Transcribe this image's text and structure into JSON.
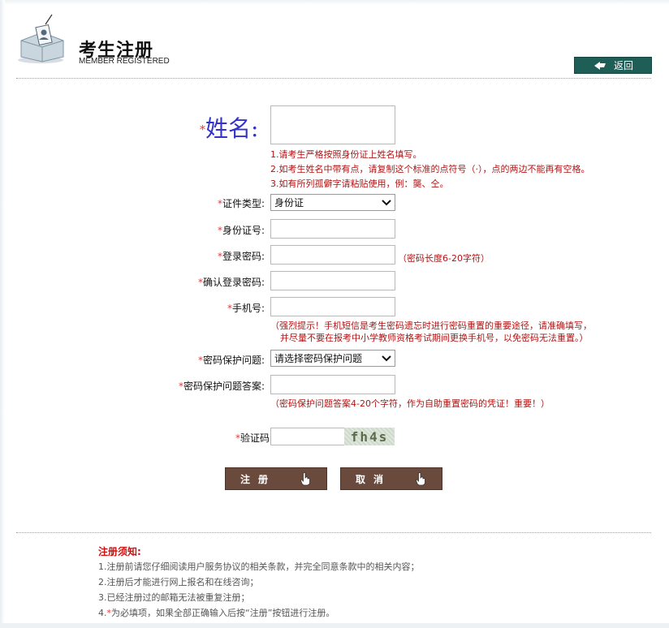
{
  "header": {
    "title_cn": "考生注册",
    "title_en": "MEMBER REGISTERED",
    "back_label": "返回"
  },
  "required_mark": "*",
  "form": {
    "name": {
      "label": "姓名:",
      "value": "",
      "tips": [
        "1.请考生严格按照身份证上姓名填写。",
        "2.如考生姓名中带有点，请复制这个标准的点符号（·），点的两边不能再有空格。",
        "3.如有所列孤僻字请粘贴使用，例：龑、仝。"
      ]
    },
    "id_type": {
      "label": "证件类型:",
      "selected": "身份证"
    },
    "id_number": {
      "label": "身份证号:",
      "value": ""
    },
    "password": {
      "label": "登录密码:",
      "value": "",
      "tip": "（密码长度6-20字符）"
    },
    "password_confirm": {
      "label": "确认登录密码:",
      "value": ""
    },
    "phone": {
      "label": "手机号:",
      "value": "",
      "tip_line1": "（强烈提示！手机短信是考生密码遗忘时进行密码重置的重要途径，请准确填写，",
      "tip_line2": "并尽量不要在报考中小学教师资格考试期间更换手机号，以免密码无法重置。）"
    },
    "security_question": {
      "label": "密码保护问题:",
      "selected": "请选择密码保护问题"
    },
    "security_answer": {
      "label": "密码保护问题答案:",
      "value": "",
      "tip": "（密码保护问题答案4-20个字符，作为自助重置密码的凭证！重要！）"
    },
    "captcha": {
      "label": "验证码",
      "value": "",
      "image_text": "fh4s"
    }
  },
  "buttons": {
    "register": "注册",
    "cancel": "取消"
  },
  "notice": {
    "title": "注册须知:",
    "items": [
      "1.注册前请您仔细阅读用户服务协议的相关条款，并完全同意条款中的相关内容；",
      "2.注册后才能进行网上报名和在线咨询；",
      "3.已经注册过的邮箱无法被重复注册；"
    ],
    "item4_prefix": "4.",
    "item4_suffix": "为必填项，如果全部正确输入后按“注册”按钮进行注册。"
  },
  "colors": {
    "back_button_bg": "#1f5e56",
    "action_button_bg": "#6a4a3d",
    "tip_red": "#b01515",
    "required_red": "#e23b3b",
    "name_label_blue": "#3333cc"
  }
}
